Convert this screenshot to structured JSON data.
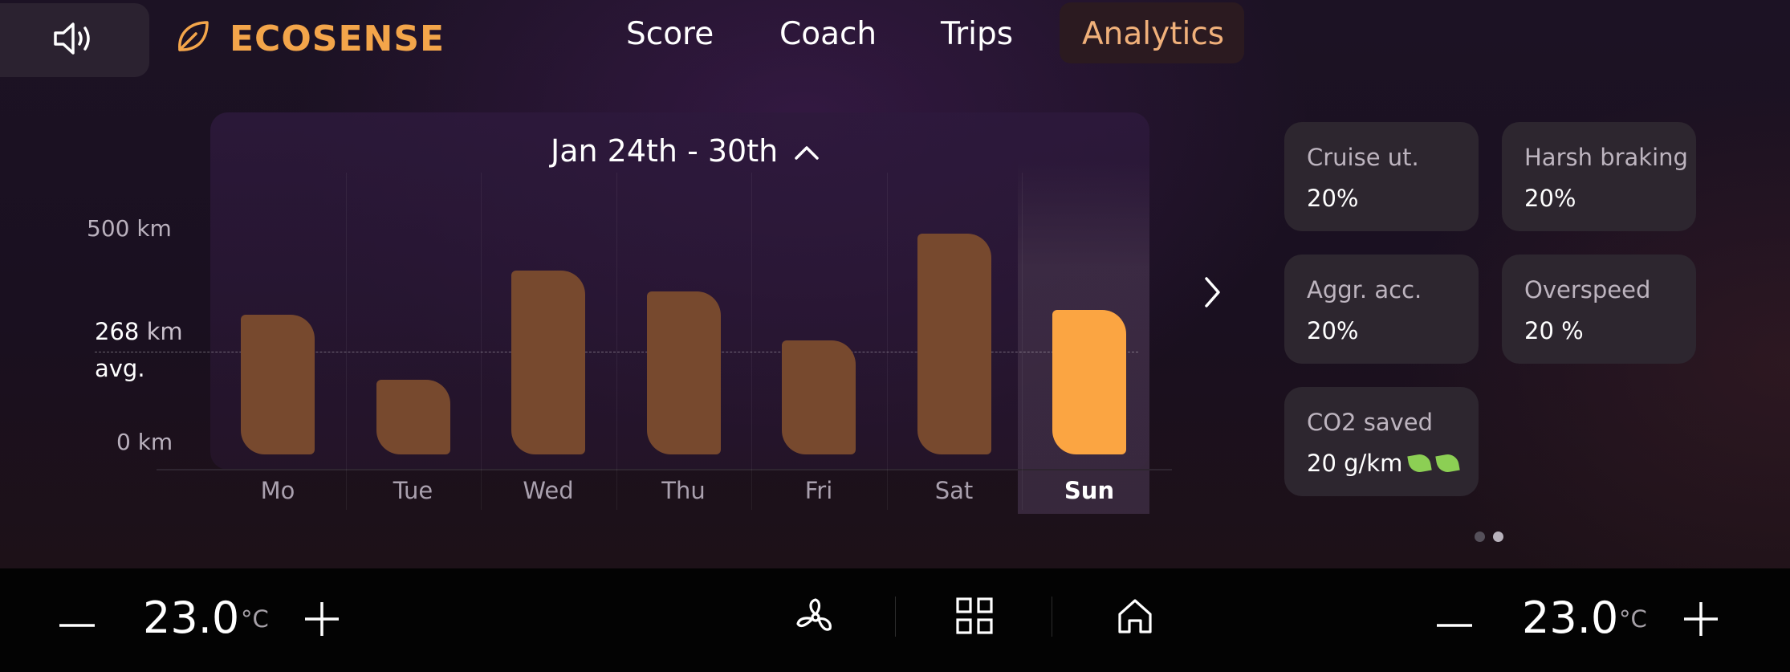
{
  "header": {
    "brand": "ECOSENSE",
    "tabs": [
      {
        "label": "Score"
      },
      {
        "label": "Coach"
      },
      {
        "label": "Trips"
      },
      {
        "label": "Analytics"
      }
    ],
    "active_tab": "Analytics",
    "accent_color": "#f3a54a"
  },
  "chart": {
    "date_range": "Jan 24th - 30th",
    "y_top_label": "500 km",
    "y_bottom_label": "0 km",
    "avg_value": "268",
    "avg_unit": "km",
    "avg_label": "avg."
  },
  "chart_data": {
    "type": "bar",
    "categories": [
      "Mo",
      "Tue",
      "Wed",
      "Thu",
      "Fri",
      "Sat",
      "Sun"
    ],
    "values": [
      300,
      160,
      395,
      350,
      245,
      475,
      310
    ],
    "ylim": [
      0,
      500
    ],
    "average": 268,
    "highlighted": "Sun",
    "colors": {
      "bar": "#77492e",
      "highlight": "#fba542"
    }
  },
  "stats": [
    {
      "label": "Cruise ut.",
      "value": "20%"
    },
    {
      "label": "Harsh braking",
      "value": "20%"
    },
    {
      "label": "Aggr. acc.",
      "value": "20%"
    },
    {
      "label": "Overspeed",
      "value": "20 %"
    },
    {
      "label": "CO2 saved",
      "value": "20 g/km"
    }
  ],
  "pagination": {
    "pages": 2,
    "current": 2
  },
  "climate": {
    "left_temp": "23.0",
    "right_temp": "23.0",
    "unit": "°C"
  },
  "icons": [
    "speaker-icon",
    "leaf-icon",
    "chevron-up-icon",
    "chevron-right-icon",
    "fan-icon",
    "grid-icon",
    "home-icon",
    "minus-icon",
    "plus-icon"
  ]
}
